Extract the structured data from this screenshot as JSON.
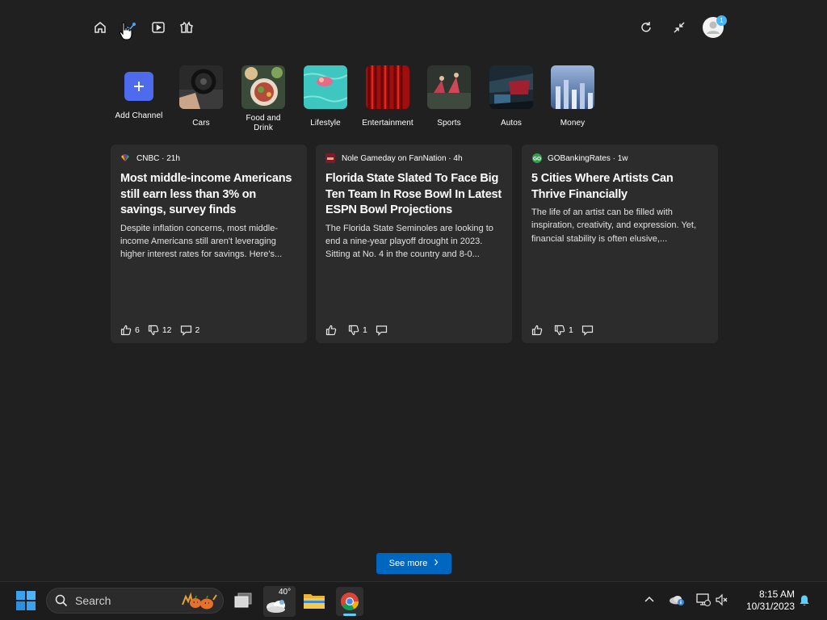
{
  "channels": [
    {
      "label": "Add Channel"
    },
    {
      "label": "Cars"
    },
    {
      "label": "Food and Drink"
    },
    {
      "label": "Lifestyle"
    },
    {
      "label": "Entertainment"
    },
    {
      "label": "Sports"
    },
    {
      "label": "Autos"
    },
    {
      "label": "Money"
    }
  ],
  "cards": [
    {
      "source": "CNBC · 21h",
      "title": "Most middle-income Americans still earn less than 3% on savings, survey finds",
      "description": "Despite inflation concerns, most middle-income Americans still aren't leveraging higher interest rates for savings. Here's...",
      "likes": "6",
      "dislikes": "12",
      "comments": "2"
    },
    {
      "source": "Nole Gameday on FanNation · 4h",
      "title": "Florida State Slated To Face Big Ten Team In Rose Bowl In Latest ESPN Bowl Projections",
      "description": "The Florida State Seminoles are looking to end a nine-year playoff drought in 2023. Sitting at No. 4 in the country and 8-0...",
      "likes": "",
      "dislikes": "1",
      "comments": ""
    },
    {
      "source": "GOBankingRates · 1w",
      "title": "5 Cities Where Artists Can Thrive Financially",
      "description": "The life of an artist can be filled with inspiration, creativity, and expression. Yet, financial stability is often elusive,...",
      "likes": "",
      "dislikes": "1",
      "comments": ""
    }
  ],
  "see_more": {
    "label": "See more"
  },
  "header": {
    "notification_badge": "1"
  },
  "taskbar": {
    "search_placeholder": "Search",
    "weather_temp": "40°",
    "time": "8:15 AM",
    "date": "10/31/2023"
  },
  "colors": {
    "background": "#202020",
    "card": "#2c2c2c",
    "accent": "#4f6bed",
    "see_more_button": "#0067c0"
  }
}
